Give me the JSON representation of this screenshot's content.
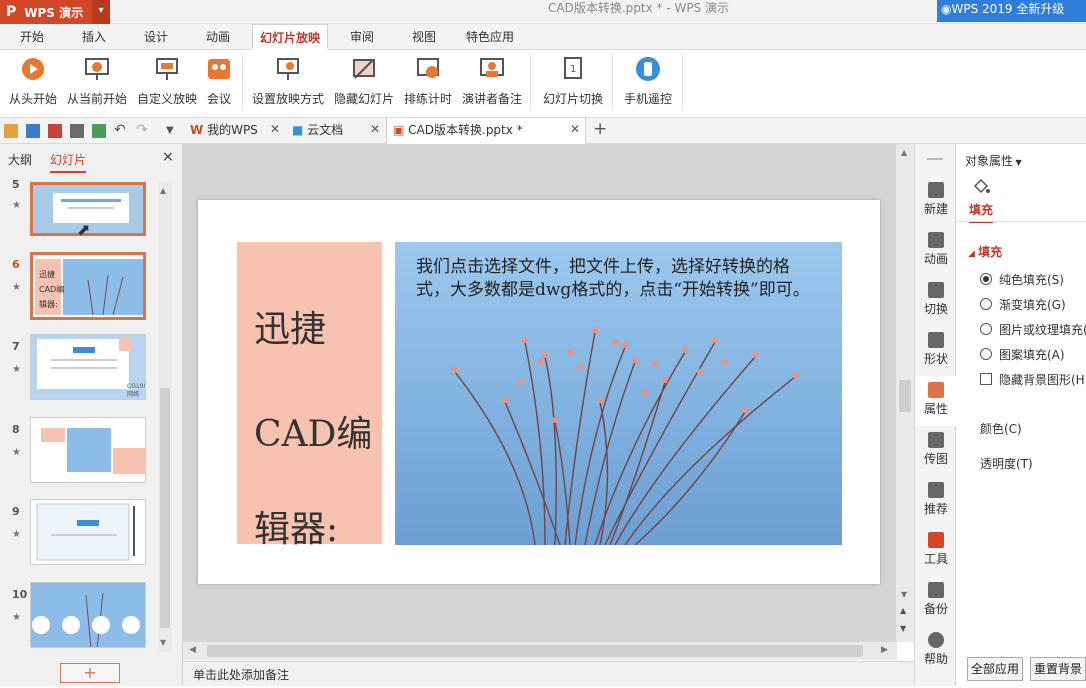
{
  "app": {
    "name": "WPS 演示",
    "logo_glyph": "P",
    "window_title": "CAD版本转换.pptx * - WPS 演示",
    "upgrade": "WPS 2019 全新升级"
  },
  "tabs": [
    "开始",
    "插入",
    "设计",
    "动画",
    "幻灯片放映",
    "审阅",
    "视图",
    "特色应用"
  ],
  "active_tab": "幻灯片放映",
  "ribbon": [
    {
      "label": "从头开始",
      "icon": "play-icon"
    },
    {
      "label": "从当前开始",
      "icon": "play-current-icon"
    },
    {
      "label": "自定义放映",
      "icon": "custom-show-icon"
    },
    {
      "label": "会议",
      "icon": "meeting-icon"
    },
    {
      "label": "设置放映方式",
      "icon": "setup-show-icon"
    },
    {
      "label": "隐藏幻灯片",
      "icon": "hide-slide-icon"
    },
    {
      "label": "排练计时",
      "icon": "rehearse-timing-icon"
    },
    {
      "label": "演讲者备注",
      "icon": "speaker-notes-icon"
    },
    {
      "label": "幻灯片切换",
      "icon": "slide-transition-icon"
    },
    {
      "label": "手机遥控",
      "icon": "phone-remote-icon"
    }
  ],
  "doc_tabs": [
    {
      "label": "我的WPS",
      "icon": "wps-logo-icon"
    },
    {
      "label": "云文档",
      "icon": "cloud-cube-icon"
    },
    {
      "label": "CAD版本转换.pptx *",
      "icon": "pptx-file-icon"
    }
  ],
  "panel": {
    "tab_outline": "大纲",
    "tab_slides": "幻灯片",
    "close": "×",
    "add": "+"
  },
  "thumbnails": [
    {
      "num": "5",
      "selected": false
    },
    {
      "num": "6",
      "selected": true
    },
    {
      "num": "7",
      "selected": false
    },
    {
      "num": "8",
      "selected": false
    },
    {
      "num": "9",
      "selected": false
    },
    {
      "num": "10",
      "selected": false
    }
  ],
  "thumb_texts": {
    "slide6_left": "迅捷\nCAD编\n辑器:",
    "slide7_corner": "CG1000\n网络"
  },
  "slide": {
    "title_lines": [
      "迅捷",
      "CAD编",
      "辑器:"
    ],
    "body": "我们点击选择文件，把文件上传，选择好转换的格式，大多数都是dwg格式的，点击“开始转换”即可。"
  },
  "notes_placeholder": "单击此处添加备注",
  "right_toolbar": [
    {
      "label": "新建",
      "icon": "new-icon"
    },
    {
      "label": "动画",
      "icon": "animation-icon"
    },
    {
      "label": "切换",
      "icon": "switch-icon"
    },
    {
      "label": "形状",
      "icon": "shape-icon"
    },
    {
      "label": "属性",
      "icon": "property-icon"
    },
    {
      "label": "传图",
      "icon": "upload-image-icon"
    },
    {
      "label": "推荐",
      "icon": "recommend-icon"
    },
    {
      "label": "工具",
      "icon": "toolbox-icon"
    },
    {
      "label": "备份",
      "icon": "backup-icon"
    },
    {
      "label": "帮助",
      "icon": "help-icon"
    }
  ],
  "properties": {
    "header": "对象属性",
    "fill_tab": "填充",
    "section": "填充",
    "options": [
      {
        "label": "纯色填充(S)",
        "checked": true
      },
      {
        "label": "渐变填充(G)",
        "checked": false
      },
      {
        "label": "图片或纹理填充(",
        "checked": false
      },
      {
        "label": "图案填充(A)",
        "checked": false
      }
    ],
    "hide_bg": "隐藏背景图形(H)",
    "color_label": "颜色(C)",
    "transparency_label": "透明度(T)",
    "apply_all": "全部应用",
    "reset_bg": "重置背景"
  },
  "colors": {
    "accent": "#d24726",
    "upgrade_blue": "#2f7ede",
    "pink": "#f7c3b0",
    "sky": "#8cbde8"
  }
}
